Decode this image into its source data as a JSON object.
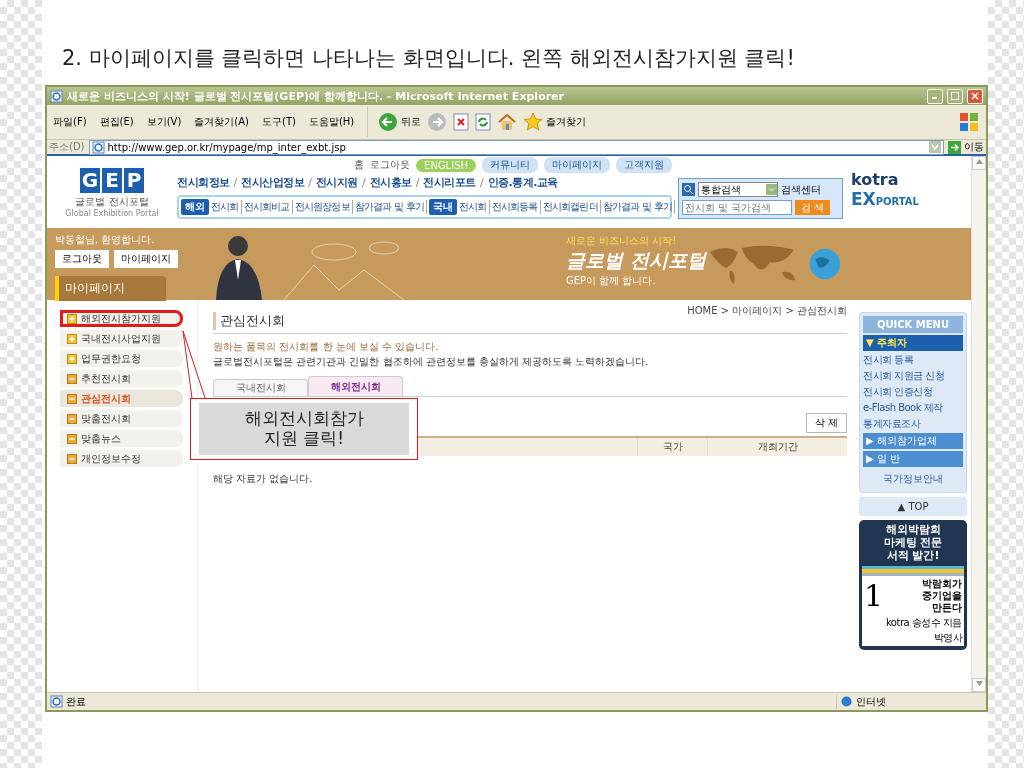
{
  "slide_title": "2. 마이페이지를 클릭하면 나타나는 화면입니다. 왼쪽 해외전시참가지원 클릭!",
  "window": {
    "title": "새로운 비즈니스의 시작! 글로벌 전시포털(GEP)에 함께합니다. - Microsoft Internet Explorer",
    "menu": [
      "파일(F)",
      "편집(E)",
      "보기(V)",
      "즐겨찾기(A)",
      "도구(T)",
      "도움말(H)"
    ],
    "toolbar": [
      {
        "kind": "back",
        "label": "뒤로"
      },
      {
        "kind": "forward"
      },
      {
        "kind": "stop"
      },
      {
        "kind": "refresh"
      },
      {
        "kind": "home"
      },
      {
        "kind": "favorites",
        "label": "즐겨찾기"
      }
    ],
    "address_label": "주소(D)",
    "url": "http://www.gep.or.kr/mypage/mp_inter_exbt.jsp",
    "go": "이동"
  },
  "site": {
    "logo": {
      "mark": [
        "G",
        "E",
        "P"
      ],
      "name": "글로벌 전시포털",
      "tagline": "Global Exhibition Portal"
    },
    "top_links": [
      "홈",
      "로그아웃"
    ],
    "english": "ENGLISH",
    "top_buttons": [
      "커뮤니티",
      "마이페이지",
      "고객지원"
    ],
    "nav_separator": "/",
    "nav": [
      "전시회정보",
      "전시산업정보",
      "전시지원",
      "전시홍보",
      "전시리포트",
      "인증.통계.교육"
    ],
    "subnav": [
      {
        "badge": "해외",
        "links": [
          "전시회",
          "전시회비교",
          "전시원장정보",
          "참가결과 및 후기"
        ]
      },
      {
        "badge": "국내",
        "links": [
          "전시회",
          "전시회등록",
          "전시회캘린더",
          "참가결과 및 후기"
        ]
      }
    ],
    "search": {
      "scope": "통합검색",
      "center": "검색센터",
      "placeholder": "전시회 및 국가검색",
      "button": "검 색"
    },
    "partner": {
      "name": "kotra",
      "mark": "EX",
      "word": "PORTAL"
    }
  },
  "banner": {
    "welcome": "박동철님, 환영합니다.",
    "buttons": [
      "로그아웃",
      "마이페이지"
    ],
    "section": "마이페이지",
    "slogan": "새로운 비즈니스의 시작!",
    "title": "글로벌 전시포털",
    "subtitle": "GEP이 함께 합니다."
  },
  "sidebar": {
    "items": [
      {
        "label": "해외전시참가지원",
        "kind": "expand",
        "selected": false,
        "highlighted": true
      },
      {
        "label": "국내전시사업지원",
        "kind": "expand",
        "selected": false,
        "highlighted": false
      },
      {
        "label": "업무권한요청",
        "kind": "expand",
        "selected": false,
        "highlighted": false
      },
      {
        "label": "추천전시회",
        "kind": "page",
        "selected": false,
        "highlighted": false
      },
      {
        "label": "관심전시회",
        "kind": "page",
        "selected": true,
        "highlighted": false
      },
      {
        "label": "맞춤전시회",
        "kind": "page",
        "selected": false,
        "highlighted": false
      },
      {
        "label": "맞춤뉴스",
        "kind": "page",
        "selected": false,
        "highlighted": false
      },
      {
        "label": "개인정보수정",
        "kind": "page",
        "selected": false,
        "highlighted": false
      }
    ]
  },
  "main": {
    "breadcrumb": "HOME > 마이페이지 > 관심전시회",
    "title": "관심전시회",
    "notes": [
      "원하는 품목의 전시회를 한 눈에 보실 수 있습니다.",
      "글로벌전시포털은 관련기관과 긴밀한 협조하에 관련정보를 충실하게 제공하도록 노력하겠습니다."
    ],
    "tabs": [
      {
        "label": "국내전시회",
        "selected": false
      },
      {
        "label": "해외전시회",
        "selected": true
      }
    ],
    "delete": "삭 제",
    "columns": [
      "국가",
      "개최기간"
    ],
    "empty": "해당 자료가 없습니다."
  },
  "callout": [
    "해외전시회참가",
    "지원 클릭!"
  ],
  "quick_menu": {
    "title": "QUICK MENU",
    "section": "▼ 주최자",
    "links": [
      "전시회 등록",
      "전시회 지원금 신청",
      "전시회 인증신청",
      "e-Flash Book 제작",
      "통계자료조사"
    ],
    "groups": [
      "▶ 해외참가업체",
      "▶ 일 반"
    ],
    "info": "국가정보안내",
    "top": "▲ TOP"
  },
  "ad": {
    "headline": [
      "해외박람회",
      "마케팅 전문",
      "서적 발간!"
    ],
    "number": "1",
    "book_title": [
      "박람회가",
      "중기업을",
      "만든다"
    ],
    "author": "kotra 송성수 지음",
    "publisher": "박영사"
  },
  "status": {
    "text": "완료",
    "zone": "인터넷"
  }
}
